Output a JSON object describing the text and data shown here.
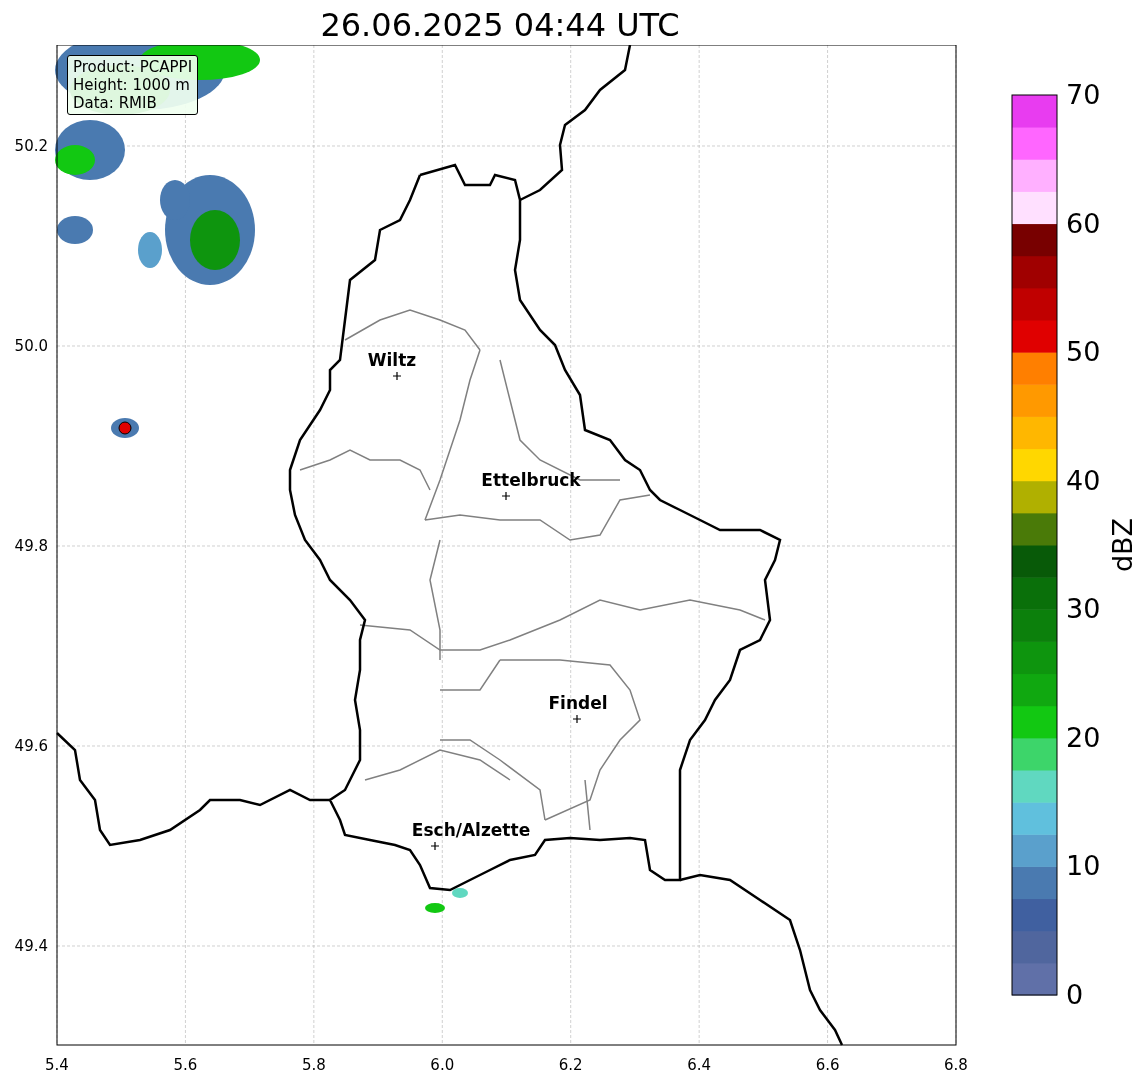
{
  "title": "26.06.2025 04:44 UTC",
  "info_box": [
    "Product: PCAPPI",
    "Height: 1000 m",
    "Data: RMIB"
  ],
  "x_ticks": [
    "5.4",
    "5.6",
    "5.8",
    "6.0",
    "6.2",
    "6.4",
    "6.6",
    "6.8"
  ],
  "y_ticks": [
    "50.2",
    "50.0",
    "49.8",
    "49.6",
    "49.4"
  ],
  "cities": [
    "Wiltz",
    "Ettelbruck",
    "Findel",
    "Esch/Alzette"
  ],
  "colorbar": {
    "label": "dBZ",
    "ticks": [
      "70",
      "60",
      "50",
      "40",
      "30",
      "20",
      "10",
      "0"
    ]
  }
}
